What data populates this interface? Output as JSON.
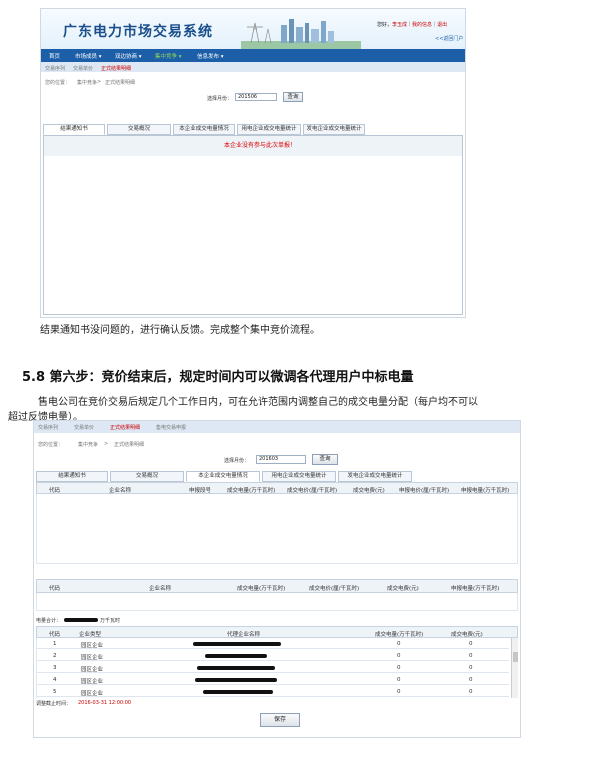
{
  "shot1": {
    "title": "广东电力市场交易系统",
    "user_links": [
      "您好，",
      "李玉成",
      "｜",
      "我的信息",
      "｜",
      "退出"
    ],
    "back_link": "<<返回门户",
    "nav": [
      "首页",
      "市场成员 ▾",
      "双边协商 ▾",
      "集中竞争 ▾",
      "信息发布 ▾"
    ],
    "subnav": [
      "交易序列",
      "交易单价",
      "正式结果明细"
    ],
    "breadcrumb": [
      "您的位置：",
      "集中竞争",
      ">",
      "正式结果明细"
    ],
    "month_label": "选择月份：",
    "month_value": "201506",
    "query_button": "查询",
    "tabs": [
      "结果通知书",
      "交易概况",
      "本企业成交电量情况",
      "用电企业成交电量统计",
      "发电企业成交电量统计"
    ],
    "notice": "本企业没有参与此次单报！"
  },
  "paragraph1": "结果通知书没问题的，进行确认反馈。完成整个集中竞价流程。",
  "section_heading": "5.8  第六步：竞价结束后，规定时间内可以微调各代理用户中标电量",
  "paragraph2_line1": "售电公司在竞价交易后规定几个工作日内，可在允许范围内调整自己的成交电量分配（每户均不可以",
  "paragraph2_line2": "超过反馈电量）。",
  "shot2": {
    "subnav": [
      "交易序列",
      "交易单价",
      "正式结果明细",
      "售电交易申报"
    ],
    "breadcrumb": [
      "您的位置：",
      "集中竞争",
      ">",
      "正式结果明细"
    ],
    "month_label": "选择月份：",
    "month_value": "201603",
    "query_button": "查询",
    "tabs": [
      "结果通知书",
      "交易概况",
      "本企业成交电量情况",
      "用电企业成交电量统计",
      "发电企业成交电量统计"
    ],
    "table1_headers": [
      "代码",
      "企业名称",
      "申报段号",
      "成交电量(万千瓦时)",
      "成交电价(厘/千瓦时)",
      "成交电费(元)",
      "申报电价(厘/千瓦时)",
      "申报电量(万千瓦时)"
    ],
    "table2_headers": [
      "代码",
      "企业名称",
      "成交电量(万千瓦时)",
      "成交电价(厘/千瓦时)",
      "成交电费(元)",
      "申报电量(万千瓦时)"
    ],
    "total_label": "电量合计：",
    "total_unit": "万千瓦时",
    "table3_headers": [
      "代码",
      "企业类型",
      "代理企业名称",
      "成交电量(万千瓦时)",
      "成交电费(元)"
    ],
    "rows": [
      {
        "code": "1",
        "type": "园区企业",
        "qty": "0",
        "fee": "0"
      },
      {
        "code": "2",
        "type": "园区企业",
        "qty": "0",
        "fee": "0"
      },
      {
        "code": "3",
        "type": "园区企业",
        "qty": "0",
        "fee": "0"
      },
      {
        "code": "4",
        "type": "园区企业",
        "qty": "0",
        "fee": "0"
      },
      {
        "code": "5",
        "type": "园区企业",
        "qty": "0",
        "fee": "0"
      }
    ],
    "deadline_label": "调整截止时间：",
    "deadline_value": "2016-03-31 12:00:00",
    "save_button": "保存"
  }
}
